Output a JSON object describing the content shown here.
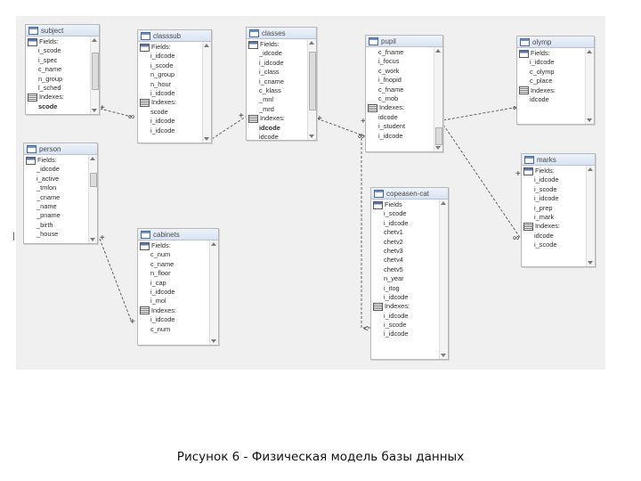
{
  "caption": "Рисунок 6 - Физическая модель базы данных",
  "tables": [
    {
      "id": "subject",
      "title": "subject",
      "rows": [
        {
          "t": "Fields:",
          "k": "fields"
        },
        {
          "t": "i_scode"
        },
        {
          "t": "i_spec"
        },
        {
          "t": "c_name"
        },
        {
          "t": "n_group"
        },
        {
          "t": "l_sched"
        },
        {
          "t": "Indexes:",
          "k": "indexes"
        },
        {
          "t": "scode",
          "b": true
        }
      ]
    },
    {
      "id": "classsub",
      "title": "classsub",
      "rows": [
        {
          "t": "Fields:",
          "k": "fields"
        },
        {
          "t": "i_idcode"
        },
        {
          "t": "i_scode"
        },
        {
          "t": "n_group"
        },
        {
          "t": "n_hour"
        },
        {
          "t": "i_idcode"
        },
        {
          "t": "Indexes:",
          "k": "indexes"
        },
        {
          "t": "scode"
        },
        {
          "t": "i_idcode"
        },
        {
          "t": "i_idcode"
        }
      ]
    },
    {
      "id": "classes",
      "title": "classes",
      "rows": [
        {
          "t": "Fields:",
          "k": "fields"
        },
        {
          "t": "_idcode"
        },
        {
          "t": "i_idcode"
        },
        {
          "t": "i_class"
        },
        {
          "t": "i_cname"
        },
        {
          "t": "c_klass"
        },
        {
          "t": "_mnl"
        },
        {
          "t": "_mrd"
        },
        {
          "t": "Indexes:",
          "k": "indexes"
        },
        {
          "t": "idcode",
          "b": true
        },
        {
          "t": "idcode"
        }
      ]
    },
    {
      "id": "pupil",
      "title": "pupil",
      "rows": [
        {
          "t": "c_fname"
        },
        {
          "t": "i_focus"
        },
        {
          "t": "c_work"
        },
        {
          "t": "i_fnopid"
        },
        {
          "t": "c_fname"
        },
        {
          "t": "c_mob"
        },
        {
          "t": "Indexes:",
          "k": "indexes"
        },
        {
          "t": "idcode"
        },
        {
          "t": "i_student"
        },
        {
          "t": "i_idcode"
        }
      ]
    },
    {
      "id": "olymp",
      "title": "olymp",
      "rows": [
        {
          "t": "Fields:",
          "k": "fields"
        },
        {
          "t": "i_idcode"
        },
        {
          "t": "c_olymp"
        },
        {
          "t": "c_place"
        },
        {
          "t": "Indexes:",
          "k": "indexes"
        },
        {
          "t": "idcode"
        }
      ]
    },
    {
      "id": "person",
      "title": "person",
      "rows": [
        {
          "t": "Fields:",
          "k": "fields"
        },
        {
          "t": "_idcode"
        },
        {
          "t": "i_active"
        },
        {
          "t": "_tmlon"
        },
        {
          "t": "_cname"
        },
        {
          "t": "_name"
        },
        {
          "t": "_pname"
        },
        {
          "t": "_birth"
        },
        {
          "t": "_house"
        }
      ]
    },
    {
      "id": "marks",
      "title": "marks",
      "rows": [
        {
          "t": "Fields:",
          "k": "fields"
        },
        {
          "t": "i_idcode"
        },
        {
          "t": "i_scode"
        },
        {
          "t": "i_idcode"
        },
        {
          "t": "i_prep"
        },
        {
          "t": "i_mark"
        },
        {
          "t": "Indexes:",
          "k": "indexes"
        },
        {
          "t": "idcode"
        },
        {
          "t": "i_scode"
        }
      ]
    },
    {
      "id": "cabinets",
      "title": "cabinets",
      "rows": [
        {
          "t": "Fields:",
          "k": "fields"
        },
        {
          "t": "c_num"
        },
        {
          "t": "c_name"
        },
        {
          "t": "n_floor"
        },
        {
          "t": "i_cap"
        },
        {
          "t": "i_idcode"
        },
        {
          "t": "i_mol"
        },
        {
          "t": "Indexes:",
          "k": "indexes"
        },
        {
          "t": "i_idcode"
        },
        {
          "t": "c_num"
        }
      ]
    },
    {
      "id": "copeasen",
      "title": "copeasen-cat",
      "rows": [
        {
          "t": "Fields",
          "k": "fields"
        },
        {
          "t": "i_scode"
        },
        {
          "t": "i_idcode"
        },
        {
          "t": "chetv1"
        },
        {
          "t": "chetv2"
        },
        {
          "t": "chetv3"
        },
        {
          "t": "chetv4"
        },
        {
          "t": "chetv5"
        },
        {
          "t": "n_year"
        },
        {
          "t": "i_itog"
        },
        {
          "t": "i_idcode"
        },
        {
          "t": "Indexes:",
          "k": "indexes"
        },
        {
          "t": "i_idcode"
        },
        {
          "t": "i_scode"
        },
        {
          "t": "i_idcode"
        }
      ]
    }
  ]
}
